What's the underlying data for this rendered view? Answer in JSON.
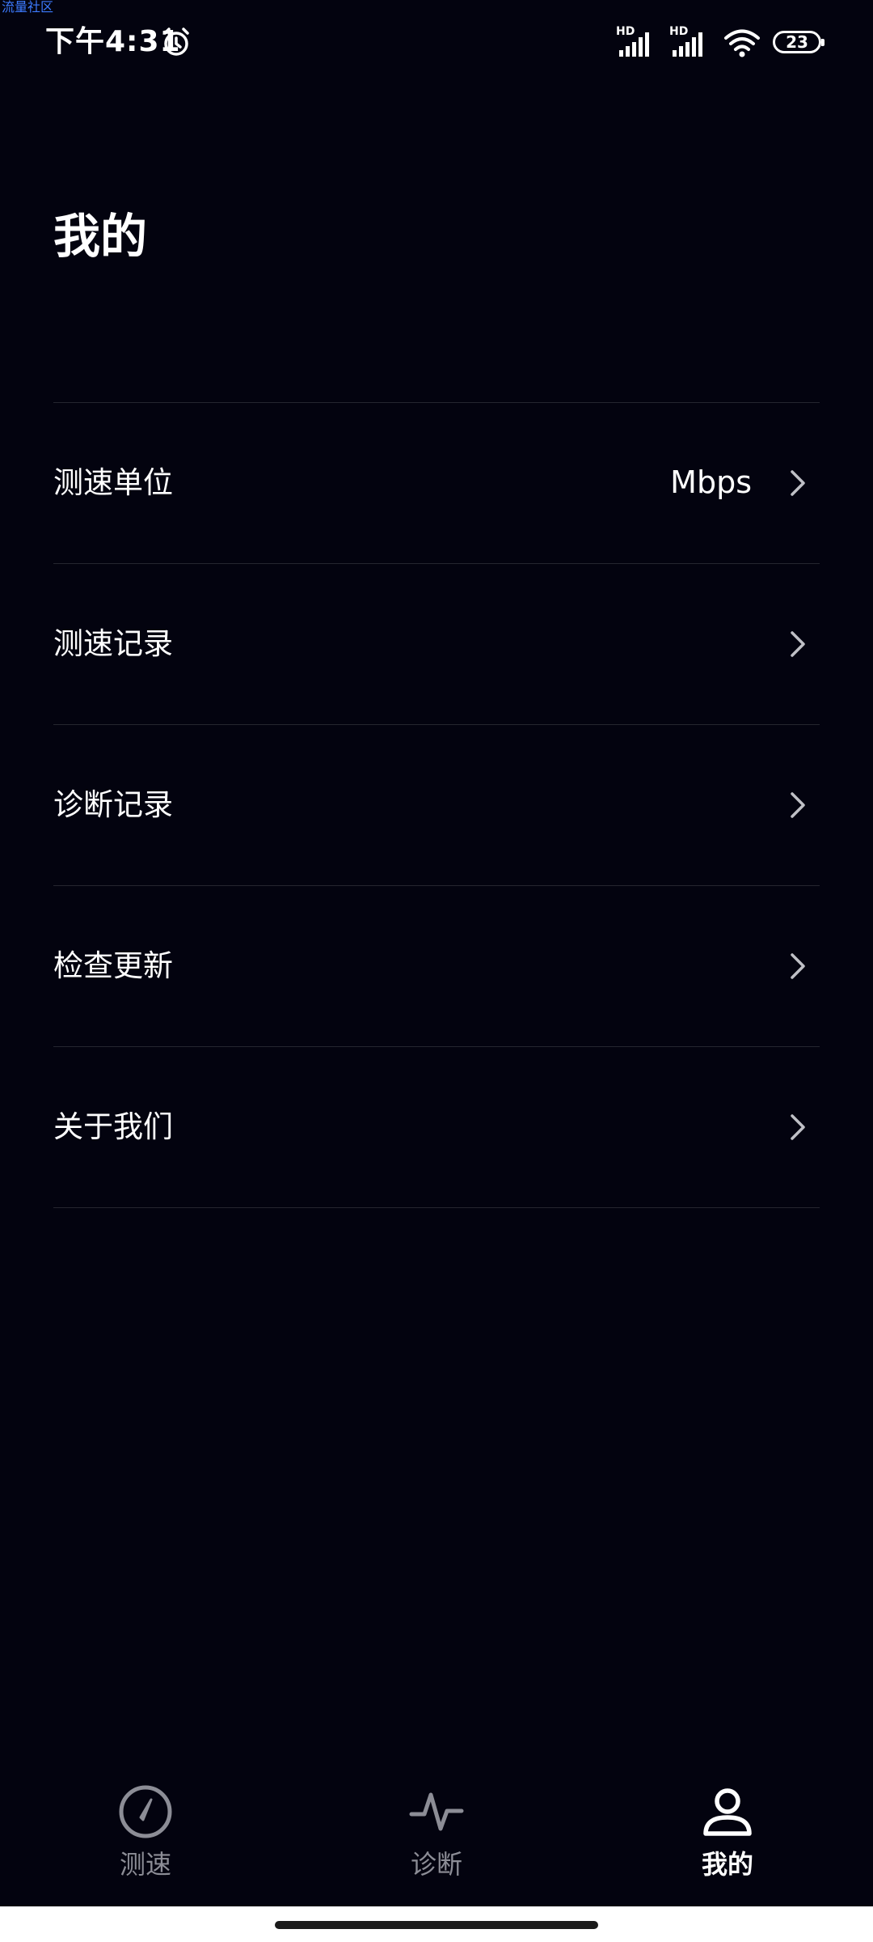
{
  "watermark": "流量社区",
  "status_bar": {
    "time": "下午4:31",
    "signal_1_label": "HD",
    "signal_2_label": "HD",
    "battery": "23",
    "icons": [
      "alarm-icon",
      "signal-icon",
      "signal-icon",
      "wifi-icon",
      "battery-icon"
    ]
  },
  "page": {
    "title": "我的"
  },
  "menu": {
    "items": [
      {
        "label": "测速单位",
        "value": "Mbps"
      },
      {
        "label": "测速记录",
        "value": ""
      },
      {
        "label": "诊断记录",
        "value": ""
      },
      {
        "label": "检查更新",
        "value": ""
      },
      {
        "label": "关于我们",
        "value": ""
      }
    ]
  },
  "tabbar": {
    "tabs": [
      {
        "label": "测速",
        "icon": "speedometer-icon",
        "active": false
      },
      {
        "label": "诊断",
        "icon": "pulse-icon",
        "active": false
      },
      {
        "label": "我的",
        "icon": "person-icon",
        "active": true
      }
    ]
  },
  "colors": {
    "background": "#03030f",
    "divider": "#25262f",
    "inactive_tab": "#8c8d96",
    "active_tab": "#ffffff",
    "watermark": "#3d7bff"
  }
}
